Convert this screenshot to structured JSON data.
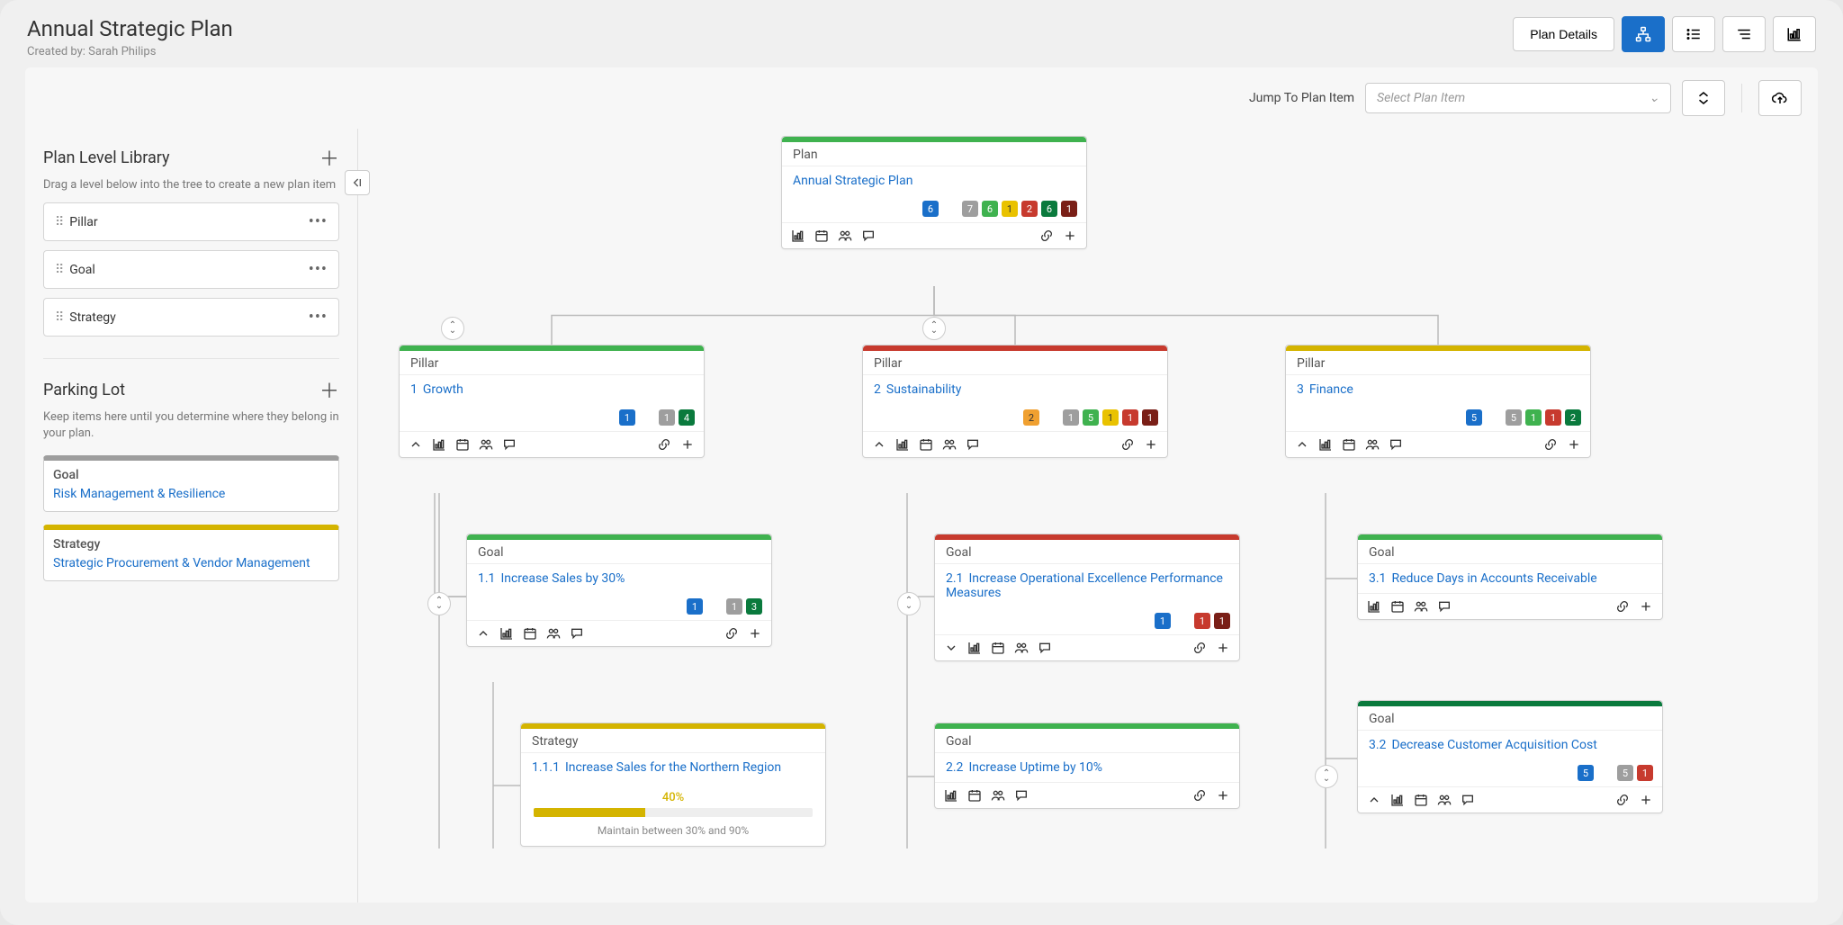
{
  "header": {
    "title": "Annual Strategic Plan",
    "creator": "Created by: Sarah Philips",
    "plan_details_label": "Plan Details"
  },
  "toolbar": {
    "jump_label": "Jump To Plan Item",
    "select_placeholder": "Select Plan Item"
  },
  "sidebar": {
    "library_title": "Plan Level Library",
    "library_help": "Drag a level below into the tree to create a new plan item",
    "levels": [
      "Pillar",
      "Goal",
      "Strategy"
    ],
    "parking_title": "Parking Lot",
    "parking_help": "Keep items here until you determine where they belong in your plan.",
    "parking_items": [
      {
        "type": "Goal",
        "title": "Risk Management & Resilience",
        "color": "goal"
      },
      {
        "type": "Strategy",
        "title": "Strategic Procurement & Vendor Management",
        "color": "strategy"
      }
    ]
  },
  "tree": {
    "root": {
      "type": "Plan",
      "title": "Annual Strategic Plan",
      "color": "green",
      "badges": [
        {
          "v": "6",
          "c": "blue"
        },
        {
          "v": "",
          "c": "spacer"
        },
        {
          "v": "7",
          "c": "gray"
        },
        {
          "v": "6",
          "c": "green"
        },
        {
          "v": "1",
          "c": "yellow"
        },
        {
          "v": "2",
          "c": "red"
        },
        {
          "v": "6",
          "c": "darkgreen"
        },
        {
          "v": "1",
          "c": "darkred"
        }
      ]
    },
    "pillars": [
      {
        "type": "Pillar",
        "num": "1",
        "title": "Growth",
        "color": "green",
        "badges": [
          {
            "v": "1",
            "c": "blue"
          },
          {
            "v": "",
            "c": "spacer"
          },
          {
            "v": "1",
            "c": "gray"
          },
          {
            "v": "4",
            "c": "darkgreen"
          }
        ],
        "goals": [
          {
            "type": "Goal",
            "num": "1.1",
            "title": "Increase Sales by 30%",
            "color": "green",
            "badges": [
              {
                "v": "1",
                "c": "blue"
              },
              {
                "v": "",
                "c": "spacer"
              },
              {
                "v": "1",
                "c": "gray"
              },
              {
                "v": "3",
                "c": "darkgreen"
              }
            ],
            "strategies": [
              {
                "type": "Strategy",
                "num": "1.1.1",
                "title": "Increase Sales for the Northern Region",
                "color": "yellow",
                "progress": {
                  "pct": "40%",
                  "value": 40,
                  "caption": "Maintain between 30% and 90%"
                }
              }
            ]
          }
        ]
      },
      {
        "type": "Pillar",
        "num": "2",
        "title": "Sustainability",
        "color": "red",
        "badges": [
          {
            "v": "2",
            "c": "orange"
          },
          {
            "v": "",
            "c": "spacer"
          },
          {
            "v": "1",
            "c": "gray"
          },
          {
            "v": "5",
            "c": "green"
          },
          {
            "v": "1",
            "c": "yellow"
          },
          {
            "v": "1",
            "c": "red"
          },
          {
            "v": "1",
            "c": "darkred"
          }
        ],
        "goals": [
          {
            "type": "Goal",
            "num": "2.1",
            "title": "Increase Operational Excellence Performance Measures",
            "color": "red",
            "expand": "down",
            "badges": [
              {
                "v": "1",
                "c": "blue"
              },
              {
                "v": "",
                "c": "spacer"
              },
              {
                "v": "1",
                "c": "red"
              },
              {
                "v": "1",
                "c": "darkred"
              }
            ]
          },
          {
            "type": "Goal",
            "num": "2.2",
            "title": "Increase Uptime by 10%",
            "color": "green",
            "nobadges": true
          }
        ]
      },
      {
        "type": "Pillar",
        "num": "3",
        "title": "Finance",
        "color": "yellow",
        "badges": [
          {
            "v": "5",
            "c": "blue"
          },
          {
            "v": "",
            "c": "spacer"
          },
          {
            "v": "5",
            "c": "gray"
          },
          {
            "v": "1",
            "c": "green"
          },
          {
            "v": "1",
            "c": "red"
          },
          {
            "v": "2",
            "c": "darkgreen"
          }
        ],
        "goals": [
          {
            "type": "Goal",
            "num": "3.1",
            "title": "Reduce Days in Accounts Receivable",
            "color": "green",
            "nobadges": true
          },
          {
            "type": "Goal",
            "num": "3.2",
            "title": "Decrease Customer Acquisition Cost",
            "color": "darkgreen",
            "badges": [
              {
                "v": "5",
                "c": "blue"
              },
              {
                "v": "",
                "c": "spacer"
              },
              {
                "v": "5",
                "c": "gray"
              },
              {
                "v": "1",
                "c": "red"
              }
            ]
          }
        ]
      }
    ]
  }
}
